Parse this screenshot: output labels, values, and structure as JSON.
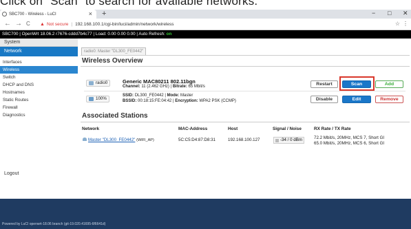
{
  "caption": "Click on \"Scan\" to search for available networks.",
  "browser": {
    "tab_title": "SBC700 - Wireless - LuCI",
    "tab_close": "×",
    "new_tab": "+",
    "win_min": "−",
    "win_max": "□",
    "win_close": "✕",
    "back": "←",
    "forward": "→",
    "reload": "C",
    "warning_icon": "▲",
    "not_secure": "Not secure",
    "separator": "|",
    "url": "192.168.100.1/cgi-bin/luci/admin/network/wireless",
    "star": "☆",
    "menu": "⋮"
  },
  "header": {
    "text": "SBC700 | OpenWrt 18.06.2 r7676-cddd7b4c77 | Load: 0.00 0.00 0.00 | Auto Refresh: ",
    "auto_refresh": "on"
  },
  "sidebar": {
    "system": "System",
    "network": "Network",
    "items": [
      "Interfaces",
      "Wireless",
      "Switch",
      "DHCP and DNS",
      "Hostnames",
      "Static Routes",
      "Firewall",
      "Diagnostics"
    ],
    "logout": "Logout"
  },
  "main": {
    "subtab": "radio0: Master \"DL300_FE0442\"",
    "title": "Wireless Overview",
    "radio": {
      "badge": "radio0",
      "title": "Generic MAC80211 802.11bgn",
      "channel_label": "Channel:",
      "channel_value": "11 (2.462 GHz)",
      "bitrate_label": "Bitrate:",
      "bitrate_value": "65 Mbit/s"
    },
    "network": {
      "badge": "100%",
      "ssid_label": "SSID:",
      "ssid_value": "DL300_FE0442",
      "mode_label": "Mode:",
      "mode_value": "Master",
      "bssid_label": "BSSID:",
      "bssid_value": "00:18:15:FE:04:42",
      "enc_label": "Encryption:",
      "enc_value": "WPA2 PSK (CCMP)"
    },
    "buttons": {
      "restart": "Restart",
      "scan": "Scan",
      "add": "Add",
      "disable": "Disable",
      "edit": "Edit",
      "remove": "Remove"
    },
    "stations_title": "Associated Stations",
    "table": {
      "headers": [
        "Network",
        "MAC-Address",
        "Host",
        "Signal / Noise",
        "RX Rate / TX Rate"
      ],
      "row": {
        "network": "Master \"DL300_FE0442\"",
        "network_suffix": "(WIFI_AP)",
        "mac": "5C:C5:D4:87:D8:31",
        "host": "192.168.100.127",
        "signal": "-34 / 0 dBm",
        "rx": "72.2 Mbit/s, 20MHz, MCS 7, Short GI",
        "tx": "65.0 Mbit/s, 20MHz, MCS 6, Short GI"
      }
    }
  },
  "footer": "Powered by LuCI openwrt-18.06 branch (git-19.020.41695-6f6641d)",
  "colors": {
    "accent": "#1a77c9",
    "header_bg": "#000000",
    "bottom_bg": "#1f3b61",
    "highlight": "#d9362a"
  }
}
